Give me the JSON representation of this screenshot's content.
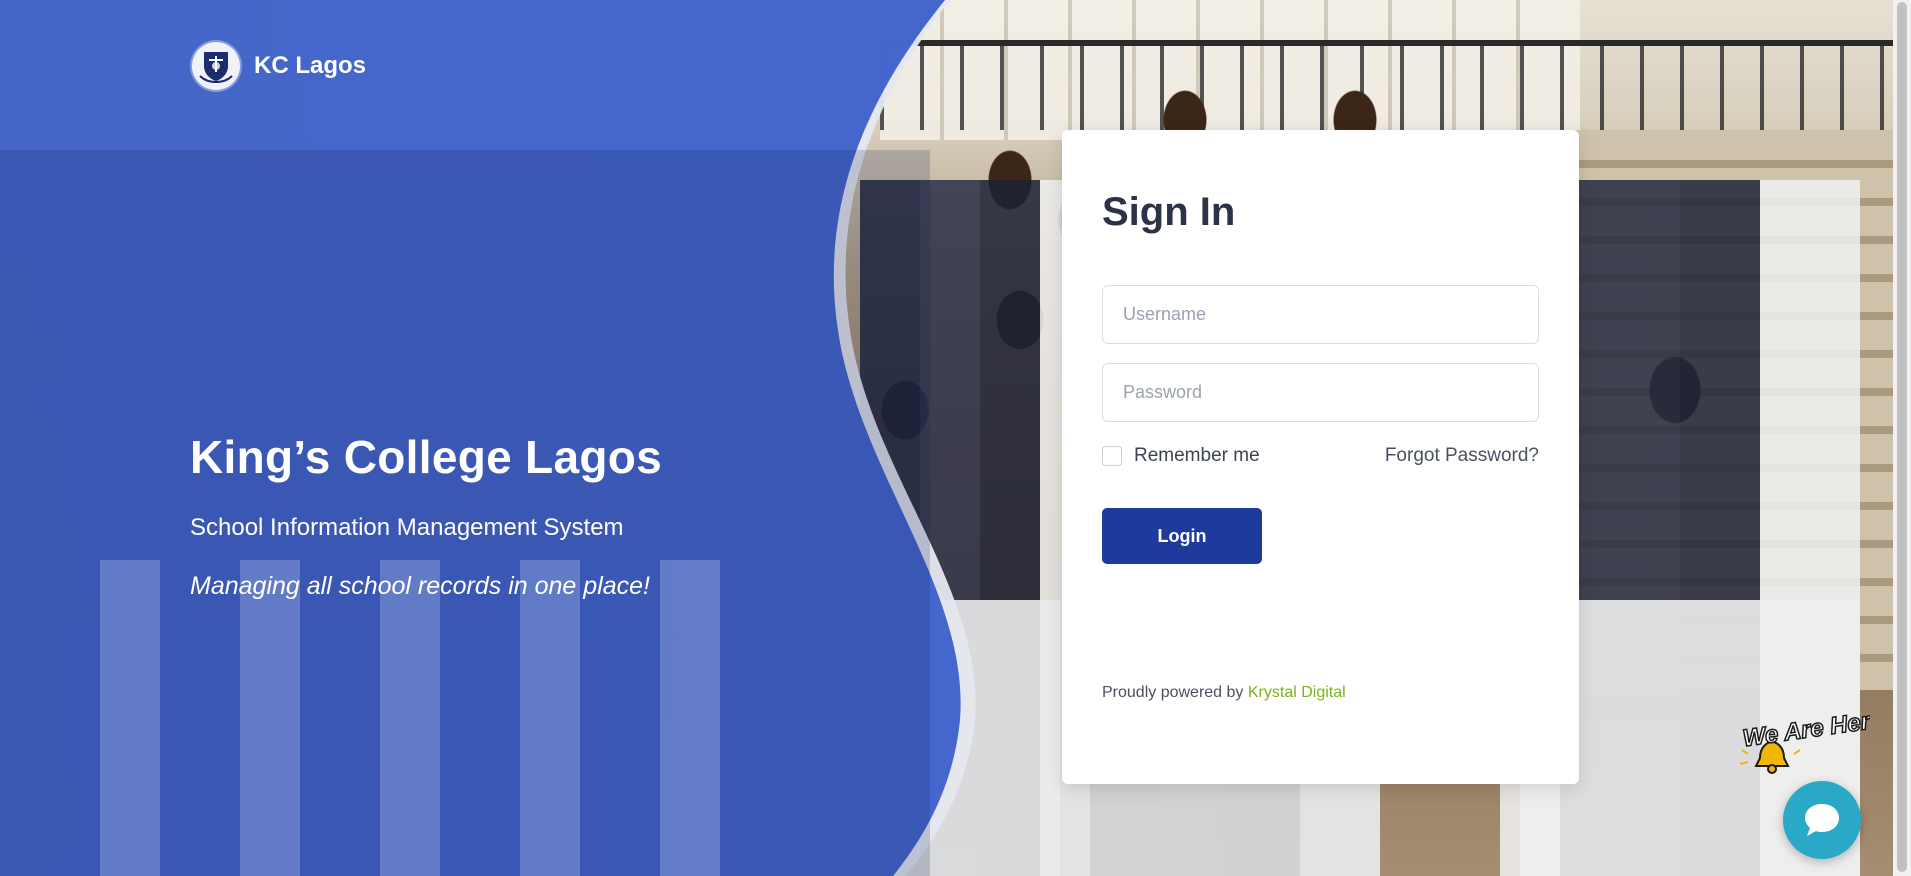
{
  "brand": {
    "name": "KC Lagos",
    "logo_icon": "school-crest-icon"
  },
  "hero": {
    "title": "King’s College Lagos",
    "subtitle": "School Information Management System",
    "tagline": "Managing all school records in one place!"
  },
  "signin": {
    "title": "Sign In",
    "username_placeholder": "Username",
    "username_value": "",
    "password_placeholder": "Password",
    "password_value": "",
    "remember_label": "Remember me",
    "remember_checked": false,
    "forgot_label": "Forgot Password?",
    "login_label": "Login",
    "powered_prefix": "Proudly powered by",
    "powered_brand": "Krystal Digital"
  },
  "chat": {
    "badge_text": "We Are Here!",
    "icon": "chat-bubble-icon"
  },
  "colors": {
    "primary": "#1d3b9c",
    "overlay_blue": "#2a4ec0",
    "powered_brand": "#7cb317",
    "chat_button": "#29a8c7",
    "title_text": "#2c3347"
  }
}
